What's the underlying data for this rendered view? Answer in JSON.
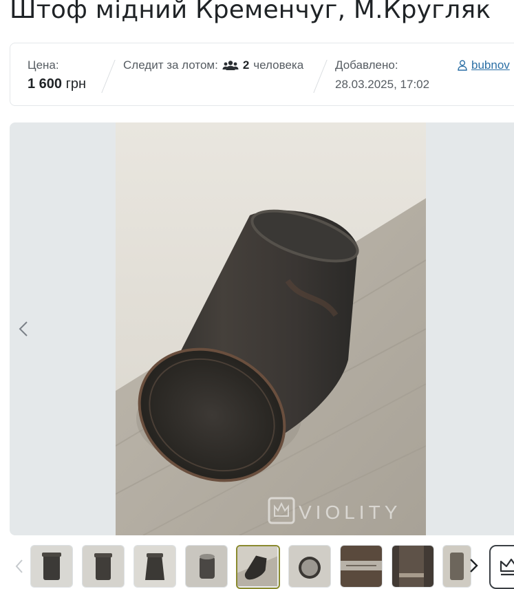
{
  "page": {
    "title": "Штоф мідний Кременчуг, М.Кругляк"
  },
  "info": {
    "price_label": "Цена:",
    "price_amount": "1 600",
    "price_currency": "грн",
    "watchers_label": "Следит за лотом:",
    "watchers_icon": "users-icon",
    "watchers_count": "2",
    "watchers_unit": "человека",
    "added_label": "Добавлено:",
    "added_date": "28.03.2025, 17:02",
    "seller_icon": "user-icon",
    "seller_name": "bubnov"
  },
  "gallery": {
    "watermark": "VIOLITY",
    "prev_icon": "chevron-left-icon",
    "thumbnail_count": 9,
    "active_thumbnail": 5,
    "next_icon": "chevron-right-icon",
    "extra_button_icon": "crown-icon"
  },
  "colors": {
    "link": "#2b6fa5",
    "active_thumb_border": "#8a8a2e",
    "gallery_bg": "#e4e8ea"
  }
}
